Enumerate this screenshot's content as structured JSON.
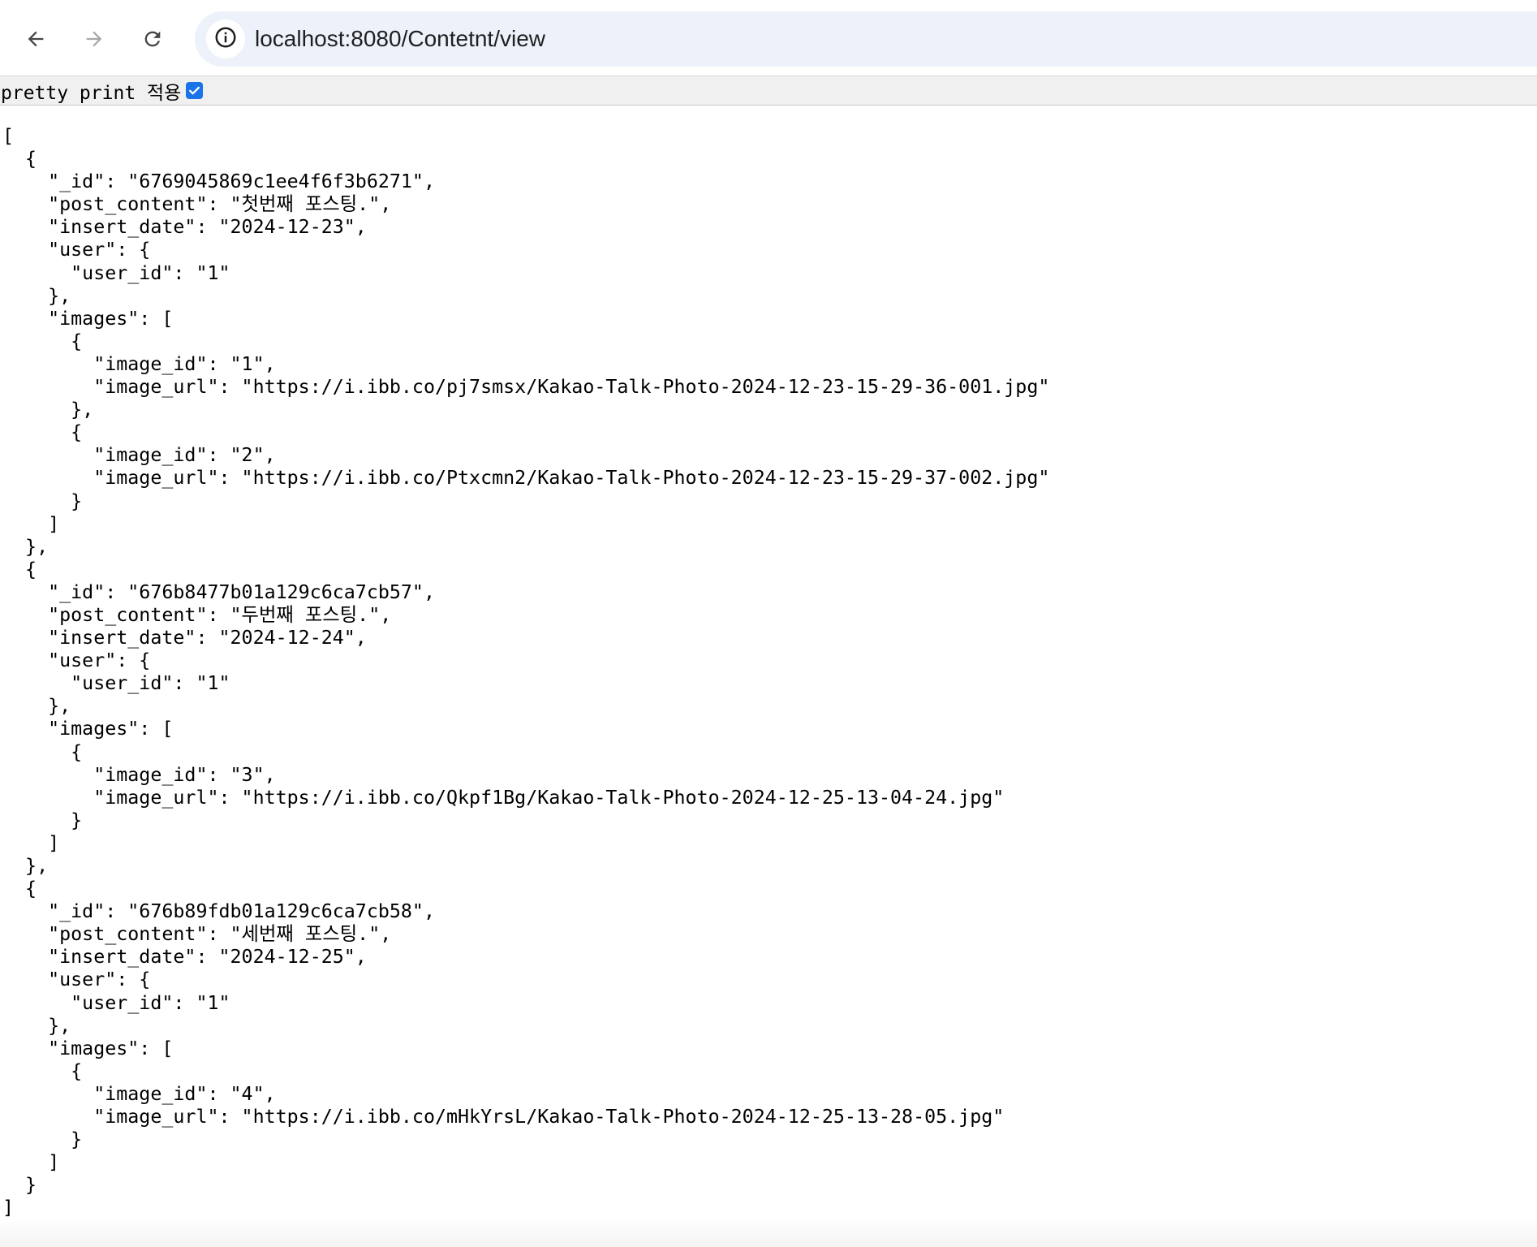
{
  "browser": {
    "url": "localhost:8080/Contetnt/view",
    "icons": {
      "back": "arrow-left-icon",
      "forward": "arrow-right-icon",
      "reload": "reload-icon",
      "site_info": "info-icon"
    }
  },
  "viewer": {
    "pretty_print_label": "pretty print 적용",
    "pretty_print_checked": true
  },
  "json_lines": [
    "[",
    "  {",
    "    \"_id\": \"6769045869c1ee4f6f3b6271\",",
    "    \"post_content\": \"첫번째 포스팅.\",",
    "    \"insert_date\": \"2024-12-23\",",
    "    \"user\": {",
    "      \"user_id\": \"1\"",
    "    },",
    "    \"images\": [",
    "      {",
    "        \"image_id\": \"1\",",
    "        \"image_url\": \"https://i.ibb.co/pj7smsx/Kakao-Talk-Photo-2024-12-23-15-29-36-001.jpg\"",
    "      },",
    "      {",
    "        \"image_id\": \"2\",",
    "        \"image_url\": \"https://i.ibb.co/Ptxcmn2/Kakao-Talk-Photo-2024-12-23-15-29-37-002.jpg\"",
    "      }",
    "    ]",
    "  },",
    "  {",
    "    \"_id\": \"676b8477b01a129c6ca7cb57\",",
    "    \"post_content\": \"두번째 포스팅.\",",
    "    \"insert_date\": \"2024-12-24\",",
    "    \"user\": {",
    "      \"user_id\": \"1\"",
    "    },",
    "    \"images\": [",
    "      {",
    "        \"image_id\": \"3\",",
    "        \"image_url\": \"https://i.ibb.co/Qkpf1Bg/Kakao-Talk-Photo-2024-12-25-13-04-24.jpg\"",
    "      }",
    "    ]",
    "  },",
    "  {",
    "    \"_id\": \"676b89fdb01a129c6ca7cb58\",",
    "    \"post_content\": \"세번째 포스팅.\",",
    "    \"insert_date\": \"2024-12-25\",",
    "    \"user\": {",
    "      \"user_id\": \"1\"",
    "    },",
    "    \"images\": [",
    "      {",
    "        \"image_id\": \"4\",",
    "        \"image_url\": \"https://i.ibb.co/mHkYrsL/Kakao-Talk-Photo-2024-12-25-13-28-05.jpg\"",
    "      }",
    "    ]",
    "  }",
    "]"
  ],
  "colors": {
    "accent": "#1a73e8",
    "omnibox_bg": "#edf2fa",
    "icon_active": "#474747",
    "icon_disabled": "#a8a8a8"
  }
}
